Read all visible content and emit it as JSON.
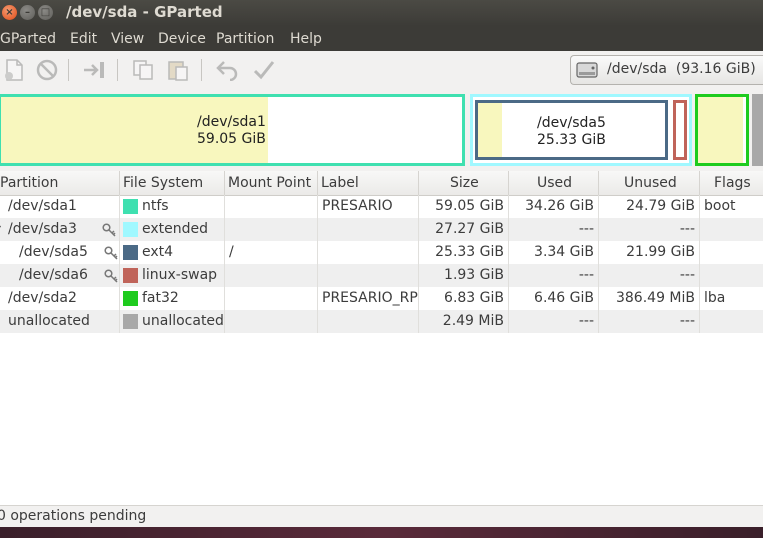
{
  "window": {
    "title": "/dev/sda - GParted"
  },
  "menubar": {
    "items": [
      "GParted",
      "Edit",
      "View",
      "Device",
      "Partition",
      "Help"
    ]
  },
  "toolbar": {
    "icons": [
      "new-icon",
      "delete-icon",
      "resize-move-icon",
      "copy-icon",
      "paste-icon",
      "undo-icon",
      "apply-icon"
    ],
    "device_selector": "/dev/sda  (93.16 GiB)"
  },
  "diskmap": {
    "sda1": {
      "name": "/dev/sda1",
      "size": "59.05 GiB",
      "used_fraction": 0.58,
      "color": "#3fe0b0"
    },
    "sda3": {
      "color": "#a0f8ff"
    },
    "sda5": {
      "name": "/dev/sda5",
      "size": "25.33 GiB",
      "used_fraction": 0.13,
      "color": "#4b6a86"
    },
    "sda6": {
      "color": "#c0645a"
    },
    "sda2": {
      "color": "#1ecb1e",
      "used_fraction": 0.94
    },
    "unallocated": {
      "color": "#a8a8a8"
    }
  },
  "table": {
    "headers": [
      "Partition",
      "File System",
      "Mount Point",
      "Label",
      "Size",
      "Used",
      "Unused",
      "Flags"
    ],
    "rows": [
      {
        "partition": "/dev/sda1",
        "fs": "ntfs",
        "fs_color": "#3fe0b0",
        "mount": "",
        "label": "PRESARIO",
        "size": "59.05 GiB",
        "used": "34.26 GiB",
        "unused": "24.79 GiB",
        "flags": "boot",
        "key": false,
        "indent": 0,
        "expander": ""
      },
      {
        "partition": "/dev/sda3",
        "fs": "extended",
        "fs_color": "#a0f8ff",
        "mount": "",
        "label": "",
        "size": "27.27 GiB",
        "used": "---",
        "unused": "---",
        "flags": "",
        "key": true,
        "indent": 0,
        "expander": "▾"
      },
      {
        "partition": "/dev/sda5",
        "fs": "ext4",
        "fs_color": "#4b6a86",
        "mount": "/",
        "label": "",
        "size": "25.33 GiB",
        "used": "3.34 GiB",
        "unused": "21.99 GiB",
        "flags": "",
        "key": true,
        "indent": 1,
        "expander": ""
      },
      {
        "partition": "/dev/sda6",
        "fs": "linux-swap",
        "fs_color": "#c0645a",
        "mount": "",
        "label": "",
        "size": "1.93 GiB",
        "used": "---",
        "unused": "---",
        "flags": "",
        "key": true,
        "indent": 1,
        "expander": ""
      },
      {
        "partition": "/dev/sda2",
        "fs": "fat32",
        "fs_color": "#1ecb1e",
        "mount": "",
        "label": "PRESARIO_RP",
        "size": "6.83 GiB",
        "used": "6.46 GiB",
        "unused": "386.49 MiB",
        "flags": "lba",
        "key": false,
        "indent": 0,
        "expander": ""
      },
      {
        "partition": "unallocated",
        "fs": "unallocated",
        "fs_color": "#a8a8a8",
        "mount": "",
        "label": "",
        "size": "2.49 MiB",
        "used": "---",
        "unused": "---",
        "flags": "",
        "key": false,
        "indent": 0,
        "expander": ""
      }
    ]
  },
  "status": {
    "text": "0 operations pending"
  }
}
